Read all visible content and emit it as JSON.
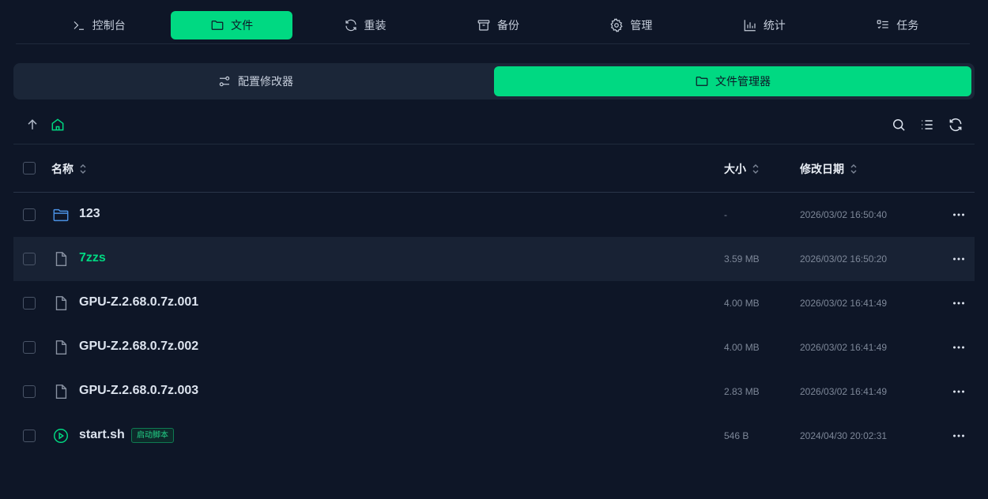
{
  "nav": {
    "tabs": [
      {
        "label": "控制台",
        "icon": "terminal-icon"
      },
      {
        "label": "文件",
        "icon": "folder-icon",
        "active": true
      },
      {
        "label": "重装",
        "icon": "refresh-icon"
      },
      {
        "label": "备份",
        "icon": "archive-icon"
      },
      {
        "label": "管理",
        "icon": "gear-icon"
      },
      {
        "label": "统计",
        "icon": "bar-chart-icon"
      },
      {
        "label": "任务",
        "icon": "task-list-icon"
      }
    ]
  },
  "subtabs": [
    {
      "label": "配置修改器",
      "icon": "sliders-icon"
    },
    {
      "label": "文件管理器",
      "icon": "folder-icon",
      "active": true
    }
  ],
  "table": {
    "headers": {
      "name": "名称",
      "size": "大小",
      "modified": "修改日期"
    },
    "rows": [
      {
        "name": "123",
        "type": "folder",
        "size": "-",
        "modified": "2026/03/02 16:50:40"
      },
      {
        "name": "7zzs",
        "type": "file",
        "size": "3.59 MB",
        "modified": "2026/03/02 16:50:20",
        "highlight": true
      },
      {
        "name": "GPU-Z.2.68.0.7z.001",
        "type": "file",
        "size": "4.00 MB",
        "modified": "2026/03/02 16:41:49"
      },
      {
        "name": "GPU-Z.2.68.0.7z.002",
        "type": "file",
        "size": "4.00 MB",
        "modified": "2026/03/02 16:41:49"
      },
      {
        "name": "GPU-Z.2.68.0.7z.003",
        "type": "file",
        "size": "2.83 MB",
        "modified": "2026/03/02 16:41:49"
      },
      {
        "name": "start.sh",
        "type": "script",
        "size": "546 B",
        "modified": "2024/04/30 20:02:31",
        "badge": "启动脚本"
      }
    ]
  },
  "colors": {
    "accent": "#00d982",
    "background": "#0e1627",
    "folder": "#4a90e2"
  }
}
